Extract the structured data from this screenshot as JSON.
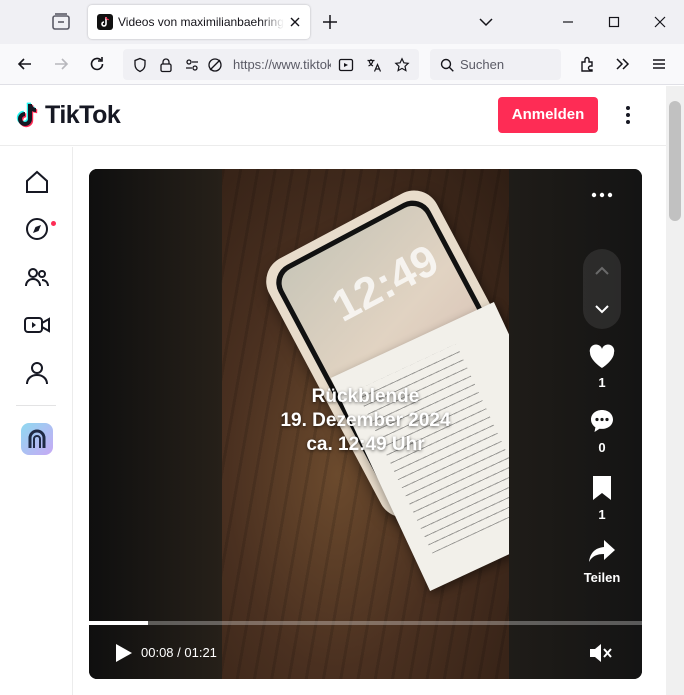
{
  "browser": {
    "tab_title": "Videos von maximilianbaehring",
    "url": "https://www.tiktok.com/",
    "search_placeholder": "Suchen"
  },
  "tiktok": {
    "logo_text": "TikTok",
    "login_label": "Anmelden",
    "brand_color": "#fe2c55"
  },
  "sidebar": {
    "items": [
      "home-icon",
      "explore-icon",
      "following-icon",
      "live-icon",
      "profile-icon",
      "app-icon"
    ]
  },
  "video": {
    "overlay_lines": [
      "Rückblende",
      "19. Dezember 2024",
      "ca. 12:49 Uhr"
    ],
    "phone_clock": "12:49",
    "likes": "1",
    "comments": "0",
    "saves": "1",
    "share_label": "Teilen",
    "current_time": "00:08",
    "duration": "01:21",
    "time_display": "00:08 / 01:21",
    "progress_fraction": 0.107
  }
}
